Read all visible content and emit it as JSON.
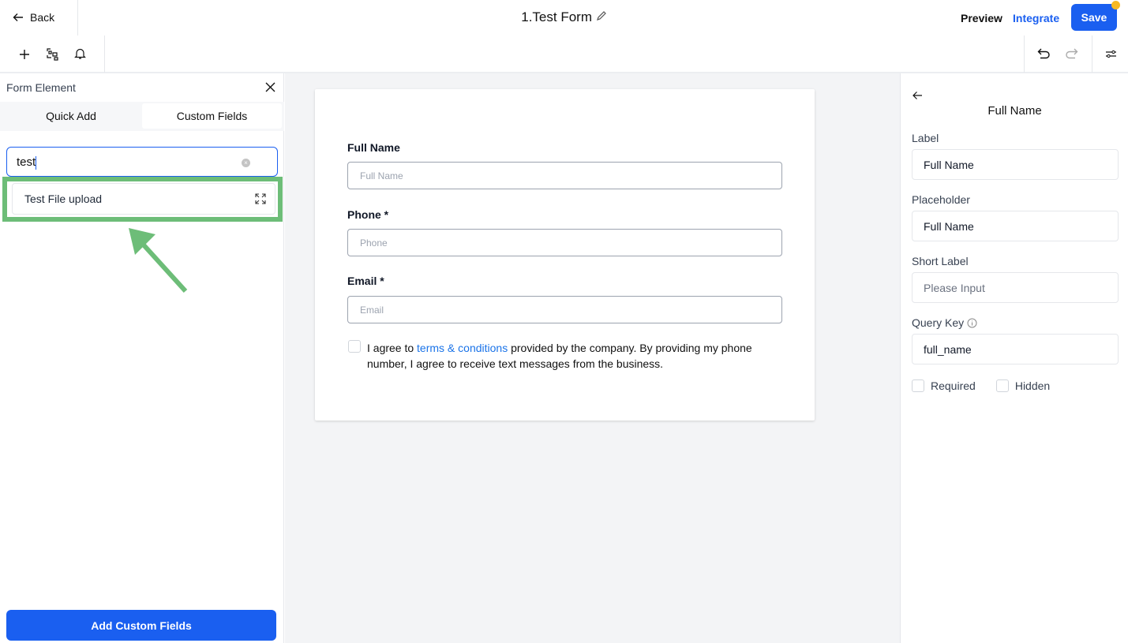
{
  "header": {
    "back_label": "Back",
    "title": "1.Test Form",
    "preview_label": "Preview",
    "integrate_label": "Integrate",
    "save_label": "Save"
  },
  "toolbar": {
    "icons": [
      "plus-icon",
      "layout-icon",
      "bell-icon",
      "undo-icon",
      "redo-icon",
      "settings-sliders-icon"
    ]
  },
  "left_panel": {
    "title": "Form Element",
    "tabs": [
      {
        "label": "Quick Add",
        "active": false
      },
      {
        "label": "Custom Fields",
        "active": true
      }
    ],
    "search_value": "test",
    "results": [
      {
        "label": "Test File upload"
      }
    ],
    "add_button_label": "Add Custom Fields"
  },
  "form": {
    "fields": [
      {
        "label": "Full Name",
        "placeholder": "Full Name"
      },
      {
        "label": "Phone *",
        "placeholder": "Phone"
      },
      {
        "label": "Email *",
        "placeholder": "Email"
      }
    ],
    "consent": {
      "prefix": "I agree to ",
      "link": "terms & conditions",
      "suffix": " provided by the company. By providing my phone number, I agree to receive text messages from the business."
    }
  },
  "right_panel": {
    "title": "Full Name",
    "label_label": "Label",
    "label_value": "Full Name",
    "placeholder_label": "Placeholder",
    "placeholder_value": "Full Name",
    "short_label_label": "Short Label",
    "short_label_placeholder": "Please Input",
    "query_key_label": "Query Key",
    "query_key_value": "full_name",
    "required_label": "Required",
    "hidden_label": "Hidden"
  },
  "colors": {
    "primary": "#1a5ff0",
    "highlight": "#6dbd78",
    "badge": "#f7b924",
    "link": "#1a73e8"
  }
}
